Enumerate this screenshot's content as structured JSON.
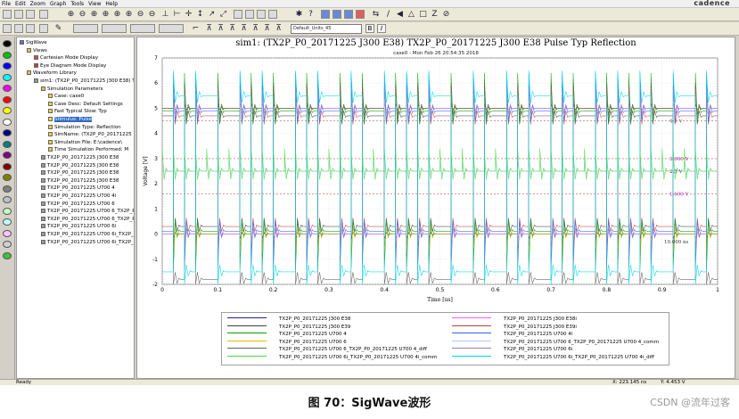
{
  "app": {
    "brand": "cadence",
    "menu": [
      "File",
      "Edit",
      "Zoom",
      "Graph",
      "Tools",
      "View",
      "Help"
    ],
    "unit_select": "Default_Units_45"
  },
  "tree": [
    {
      "depth": 0,
      "label": "SigWave",
      "icon": "app-icon"
    },
    {
      "depth": 1,
      "label": "Views",
      "icon": "folder-icon"
    },
    {
      "depth": 2,
      "label": "Cartesian Mode Display",
      "icon": "chart-icon"
    },
    {
      "depth": 2,
      "label": "Eye Diagram Mode Display",
      "icon": "eye-icon"
    },
    {
      "depth": 1,
      "label": "Waveform Library",
      "icon": "folder-icon"
    },
    {
      "depth": 2,
      "label": "sim1: (TX2P_P0_20171225 J300 E38) TX",
      "icon": "waveform-icon"
    },
    {
      "depth": 3,
      "label": "Simulation Parameters",
      "icon": "folder-icon"
    },
    {
      "depth": 4,
      "label": "Case:  case0",
      "icon": "param-icon"
    },
    {
      "depth": 4,
      "label": "Case Desc:  Default Settings",
      "icon": "param-icon"
    },
    {
      "depth": 4,
      "label": "Fast Typical Slow:  Typ",
      "icon": "param-icon"
    },
    {
      "depth": 4,
      "label": "Stimulus:  Pulse",
      "icon": "param-icon",
      "selected": true
    },
    {
      "depth": 4,
      "label": "Simulation Type:  Reflection",
      "icon": "param-icon"
    },
    {
      "depth": 4,
      "label": "SimName:  (TX2P_P0_20171225",
      "icon": "param-icon"
    },
    {
      "depth": 4,
      "label": "Simulation File:  E:\\cadence\\",
      "icon": "param-icon"
    },
    {
      "depth": 4,
      "label": "Time Simulation Performed:  M",
      "icon": "param-icon"
    },
    {
      "depth": 3,
      "label": "TX2P_P0_20171225 J300 E38",
      "icon": "waveform-icon"
    },
    {
      "depth": 3,
      "label": "TX2P_P0_20171225 J300 E38",
      "icon": "waveform-icon"
    },
    {
      "depth": 3,
      "label": "TX2P_P0_20171225 J300 E38",
      "icon": "waveform-icon"
    },
    {
      "depth": 3,
      "label": "TX2P_P0_20171225 J300 E38",
      "icon": "waveform-icon"
    },
    {
      "depth": 3,
      "label": "TX2P_P0_20171225 U700 4",
      "icon": "waveform-icon"
    },
    {
      "depth": 3,
      "label": "TX2P_P0_20171225 U700 4i",
      "icon": "waveform-icon"
    },
    {
      "depth": 3,
      "label": "TX2P_P0_20171225 U700 6",
      "icon": "waveform-icon"
    },
    {
      "depth": 3,
      "label": "TX2P_P0_20171225 U700 6_TX2P_P0",
      "icon": "waveform-icon"
    },
    {
      "depth": 3,
      "label": "TX2P_P0_20171225 U700 6_TX2P_P0",
      "icon": "waveform-icon"
    },
    {
      "depth": 3,
      "label": "TX2P_P0_20171225 U700 6i",
      "icon": "waveform-icon"
    },
    {
      "depth": 3,
      "label": "TX2P_P0_20171225 U700 6i_TX2P_P0",
      "icon": "waveform-icon"
    },
    {
      "depth": 3,
      "label": "TX2P_P0_20171225 U700 6i_TX2P_P0",
      "icon": "waveform-icon"
    }
  ],
  "palette": [
    "#000000",
    "#00c000",
    "#0000ff",
    "#00ffff",
    "#ff00ff",
    "#ff0000",
    "#ffff00",
    "#ffffff",
    "#000080",
    "#008080",
    "#800080",
    "#800000",
    "#808000",
    "#808080",
    "#c0c0c0",
    "#c0ffc0",
    "#c0ffff",
    "#ffc0ff",
    "#d0d0d0",
    "#40c040"
  ],
  "plot": {
    "title": "sim1: (TX2P_P0_20171225 J300 E38) TX2P_P0_20171225 J300 E38 Pulse Typ Reflection",
    "subtitle": "case0 - Mon Feb 26 20:54:35 2018",
    "annotations": [
      "4.5 V",
      "3.000 V",
      "2.5 V",
      "1.600 V",
      "10.000 ns"
    ]
  },
  "chart_data": {
    "type": "line",
    "title": "sim1: (TX2P_P0_20171225 J300 E38) TX2P_P0_20171225 J300 E38 Pulse Typ Reflection",
    "subtitle": "case0 - Mon Feb 26 20:54:35 2018",
    "xlabel": "Time [us]",
    "ylabel": "Voltage [V]",
    "xlim": [
      0,
      1
    ],
    "ylim": [
      -2,
      7
    ],
    "xticks": [
      "0",
      "0.1",
      "0.2",
      "0.3",
      "0.4",
      "0.5",
      "0.6",
      "0.7",
      "0.8",
      "0.9",
      "1"
    ],
    "yticks": [
      "-2",
      "-1",
      "0",
      "1",
      "2",
      "3",
      "4",
      "5",
      "6",
      "7"
    ],
    "grid": true,
    "legend_placement": "bottom",
    "reference_levels": [
      4.5,
      3.0,
      2.5,
      1.6
    ],
    "series": [
      {
        "name": "TX2P_P0_20171225 J300 E38",
        "color": "#2020a0",
        "role": "driver",
        "high": 5.0,
        "low": 0.0,
        "ring": 0.2
      },
      {
        "name": "TX2P_P0_20171225 J300 E38i",
        "color": "#ff60ff",
        "role": "driver",
        "high": 5.0,
        "low": 0.0,
        "ring": 0.2
      },
      {
        "name": "TX2P_P0_20171225 J300 E39",
        "color": "#404040",
        "role": "receiver",
        "high": 4.7,
        "low": 0.3,
        "ring": 1.2
      },
      {
        "name": "TX2P_P0_20171225 J300 E39i",
        "color": "#c04040",
        "role": "receiver",
        "high": 4.7,
        "low": 0.3,
        "ring": 1.2
      },
      {
        "name": "TX2P_P0_20171225 U700 4",
        "color": "#00a000",
        "role": "receiver",
        "high": 4.9,
        "low": 0.1,
        "ring": 1.5
      },
      {
        "name": "TX2P_P0_20171225 U700 4i",
        "color": "#3060ff",
        "role": "receiver",
        "high": 4.9,
        "low": 0.1,
        "ring": 1.5
      },
      {
        "name": "TX2P_P0_20171225 U700 6",
        "color": "#e0c000",
        "role": "receiver",
        "high": 5.0,
        "low": 0.0,
        "ring": 0.8
      },
      {
        "name": "TX2P_P0_20171225 U700 6_TX2P_P0_20171225 U700 4_comm",
        "color": "#b0c8ff",
        "role": "comm",
        "high": 2.5,
        "low": 2.5,
        "ring": 0.4
      },
      {
        "name": "TX2P_P0_20171225 U700 6_TX2P_P0_20171225 U700 4_diff",
        "color": "#606060",
        "role": "diff",
        "high": 5.0,
        "low": -5.0,
        "ring": 1.0
      },
      {
        "name": "TX2P_P0_20171225 U700 6i",
        "color": "#9080c0",
        "role": "receiver",
        "high": 5.0,
        "low": 0.0,
        "ring": 0.8
      },
      {
        "name": "TX2P_P0_20171225 U700 6i_TX2P_P0_20171225 U700 4i_comm",
        "color": "#40e040",
        "role": "comm",
        "high": 2.5,
        "low": 2.5,
        "ring": 0.9
      },
      {
        "name": "TX2P_P0_20171225 U700 6i_TX2P_P0_20171225 U700 4i_diff",
        "color": "#00d8e8",
        "role": "diff",
        "high": 5.5,
        "low": -1.5,
        "ring": 1.0
      }
    ]
  },
  "status": {
    "ready": "Ready",
    "x": "X:  223.145 ns",
    "y": "Y:  4.453 V"
  },
  "caption": "图 70：SigWave波形",
  "watermark": "CSDN @流年过客"
}
